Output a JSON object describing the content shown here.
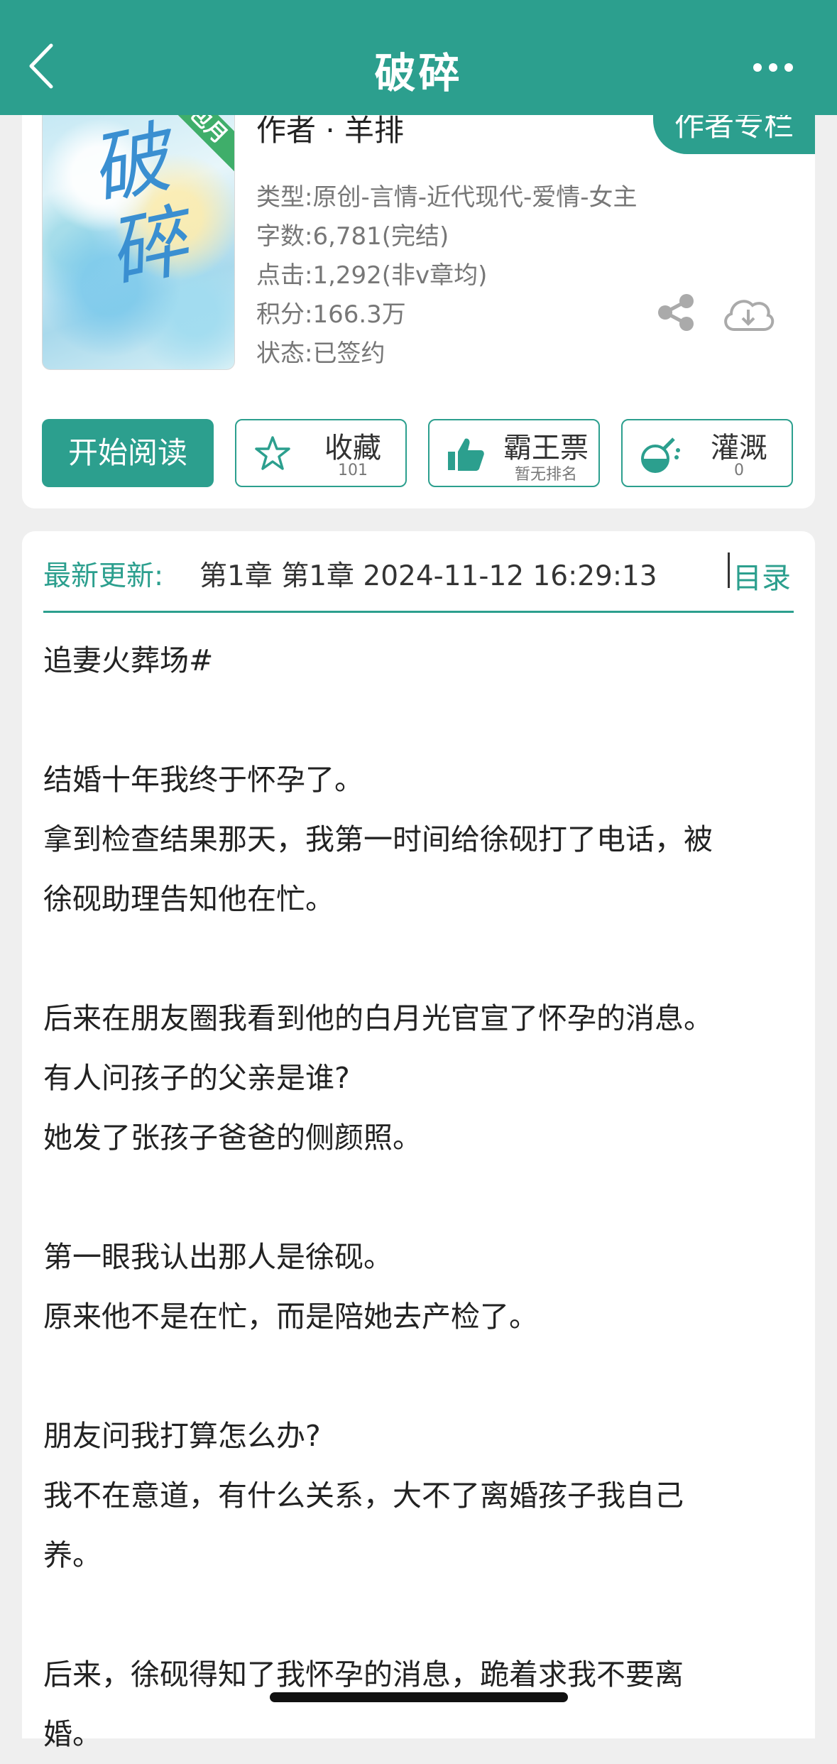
{
  "header": {
    "title": "破碎"
  },
  "book": {
    "cover_title": "破碎",
    "cover_badge": "包月",
    "author": "作者 · 羊排",
    "author_column_label": "作者专栏",
    "meta": [
      "类型:原创-言情-近代现代-爱情-女主",
      "字数:6,781(完结)",
      "点击:1,292(非v章均)",
      "积分:166.3万",
      "状态:已签约"
    ]
  },
  "actions": {
    "read_label": "开始阅读",
    "favorite": {
      "label": "收藏",
      "sub": "101"
    },
    "vote": {
      "label": "霸王票",
      "sub": "暂无排名"
    },
    "nutrient": {
      "label": "灌溉",
      "sub": "0"
    }
  },
  "update": {
    "label": "最新更新:",
    "text": "第1章 第1章 2024-11-12 16:29:13",
    "toc_label": "目录"
  },
  "story_lines": [
    "追妻火葬场#",
    "",
    "结婚十年我终于怀孕了。",
    "拿到检查结果那天，我第一时间给徐砚打了电话，被",
    "徐砚助理告知他在忙。",
    "",
    "后来在朋友圈我看到他的白月光官宣了怀孕的消息。",
    "有人问孩子的父亲是谁?",
    "她发了张孩子爸爸的侧颜照。",
    "",
    "第一眼我认出那人是徐砚。",
    "原来他不是在忙，而是陪她去产检了。",
    "",
    "朋友问我打算怎么办?",
    "我不在意道，有什么关系，大不了离婚孩子我自己",
    "养。",
    "",
    "后来，徐砚得知了我怀孕的消息，跪着求我不要离",
    "婚。"
  ],
  "colors": {
    "accent": "#2c9f8e",
    "background": "#efefef"
  }
}
